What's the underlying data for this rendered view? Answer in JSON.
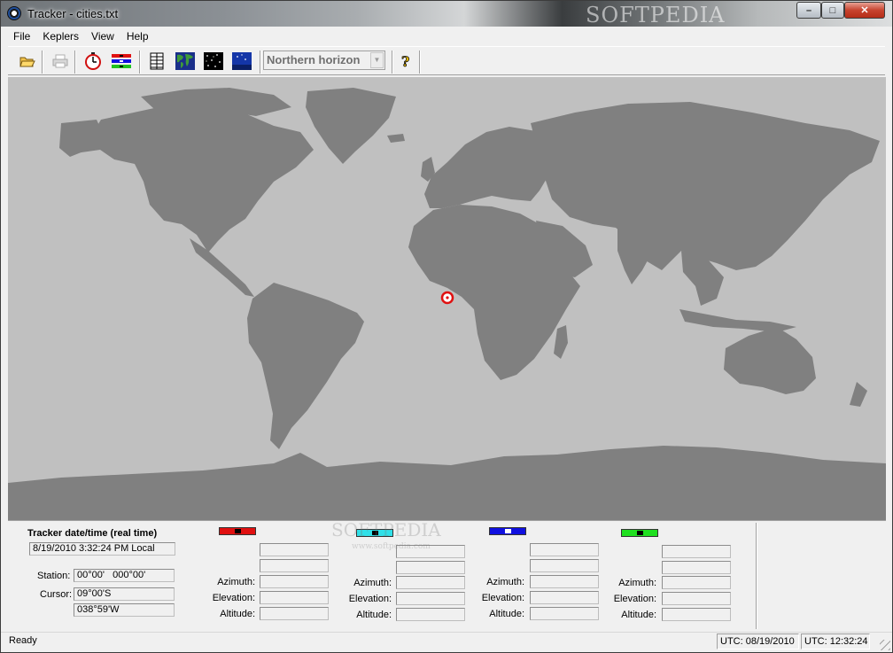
{
  "window": {
    "title": "Tracker - cities.txt",
    "watermark": "SOFTPEDIA"
  },
  "menu": [
    "File",
    "Keplers",
    "View",
    "Help"
  ],
  "toolbar": {
    "view_combo_value": "Northern horizon",
    "icons": [
      "open-folder-icon",
      "print-icon",
      "stopwatch-icon",
      "satellite-list-icon",
      "table-icon",
      "world-map-icon",
      "star-field-icon",
      "sky-view-icon",
      "help-icon"
    ]
  },
  "tracker": {
    "heading": "Tracker date/time (real time)",
    "datetime": "8/19/2010 3:32:24 PM Local",
    "station_label": "Station:",
    "station_value": "00°00'   000°00'",
    "cursor_label": "Cursor:",
    "cursor_lat": "09°00'S",
    "cursor_lon": "038°59'W"
  },
  "satellites": [
    {
      "color": "#e01010",
      "azimuth_label": "Azimuth:",
      "elevation_label": "Elevation:",
      "altitude_label": "Altitude:"
    },
    {
      "color": "#30e0e8",
      "azimuth_label": "Azimuth:",
      "elevation_label": "Elevation:",
      "altitude_label": "Altitude:"
    },
    {
      "color": "#1010e0",
      "azimuth_label": "Azimuth:",
      "elevation_label": "Elevation:",
      "altitude_label": "Altitude:"
    },
    {
      "color": "#20e020",
      "azimuth_label": "Azimuth:",
      "elevation_label": "Elevation:",
      "altitude_label": "Altitude:"
    }
  ],
  "panel_watermark": "SOFTPEDIA",
  "panel_watermark_url": "www.softpedia.com",
  "status": {
    "text": "Ready",
    "utc_date": "UTC: 08/19/2010",
    "utc_time": "UTC: 12:32:24"
  },
  "map": {
    "ocean_color": "#c0c0c0",
    "land_color": "#808080",
    "marker_color": "#e01010"
  }
}
